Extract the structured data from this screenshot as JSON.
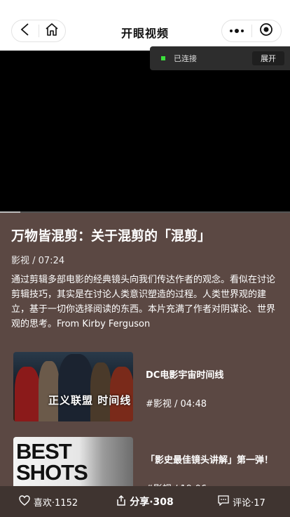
{
  "header": {
    "title": "开眼视频",
    "back_icon": "chevron-left-icon",
    "home_icon": "home-icon",
    "more_icon": "more-dots-icon",
    "close_icon": "target-close-icon"
  },
  "player": {
    "progress": 0.07,
    "cast": {
      "status_label": "已连接",
      "expand_label": "展开",
      "status_color": "#3be03b"
    }
  },
  "video": {
    "title": "万物皆混剪：关于混剪的「混剪」",
    "meta": "影视 / 07:24",
    "description": "通过剪辑多部电影的经典镜头向我们传达作者的观念。看似在讨论剪辑技巧，其实是在讨论人类意识塑造的过程。人类世界观的建立，基于一切你选择阅读的东西。本片充满了作者对阴谋论、世界观的思考。From Kirby Ferguson"
  },
  "related": [
    {
      "title": "DC电影宇宙时间线",
      "meta": "#影视 / 04:48",
      "thumb_text": "正义联盟 时间线"
    },
    {
      "title": "「影史最佳镜头讲解」第一弹！",
      "meta": "#影视 / 19:06",
      "thumb_text": "BEST SHOTS"
    }
  ],
  "actions": {
    "like_label": "喜欢·1152",
    "share_label": "分享·308",
    "comment_label": "评论·17"
  },
  "colors": {
    "background": "#5b4843",
    "bottom_bar": "#3f3430"
  }
}
